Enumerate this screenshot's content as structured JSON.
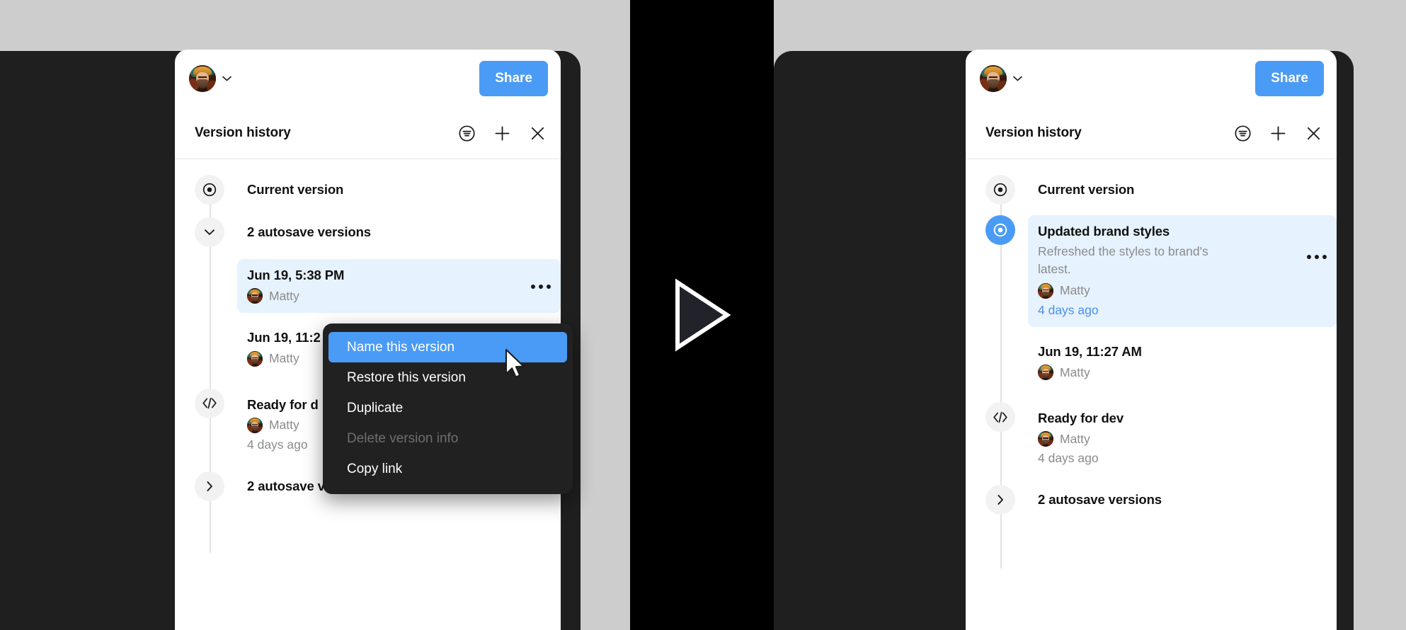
{
  "colors": {
    "accent_blue": "#4a9bf5",
    "selection_blue": "#e6f2fd",
    "link_blue": "#4a8ff0",
    "page_background": "#cdcdcd",
    "device_frame": "#1f1f1f",
    "band_black": "#000000",
    "menu_background": "#212121",
    "muted_text": "#8b8b8b"
  },
  "panels": {
    "left": {
      "topbar": {
        "avatar_alt": "Matty",
        "chevron_label": "Open account menu",
        "share_label": "Share"
      },
      "header": {
        "title": "Version history",
        "actions": [
          {
            "name": "filter-icon",
            "label": "Filter versions"
          },
          {
            "name": "plus-icon",
            "label": "Add version"
          },
          {
            "name": "close-icon",
            "label": "Close version history"
          }
        ]
      },
      "entries": [
        {
          "node": "current",
          "title": "Current version",
          "description": "",
          "author": "",
          "time": "",
          "selected": false,
          "dots": false
        },
        {
          "node": "chevron-down",
          "title": "2 autosave versions",
          "description": "",
          "author": "",
          "time": "",
          "selected": false,
          "dots": false
        },
        {
          "node": "none",
          "title": "Jun 19, 5:38 PM",
          "description": "",
          "author": "Matty",
          "time": "",
          "selected": true,
          "dots": true
        },
        {
          "node": "none",
          "title": "Jun 19, 11:2",
          "description": "",
          "author": "Matty",
          "time": "",
          "selected": false,
          "dots": false
        },
        {
          "node": "code",
          "title": "Ready for d",
          "description": "",
          "author": "Matty",
          "time": "4 days ago",
          "selected": false,
          "dots": false
        },
        {
          "node": "chevron-right",
          "title": "2 autosave versions",
          "description": "",
          "author": "",
          "time": "",
          "selected": false,
          "dots": false
        }
      ]
    },
    "right": {
      "topbar": {
        "avatar_alt": "Matty",
        "chevron_label": "Open account menu",
        "share_label": "Share"
      },
      "header": {
        "title": "Version history",
        "actions": [
          {
            "name": "filter-icon",
            "label": "Filter versions"
          },
          {
            "name": "plus-icon",
            "label": "Add version"
          },
          {
            "name": "close-icon",
            "label": "Close version history"
          }
        ]
      },
      "entries": [
        {
          "node": "current",
          "title": "Current version",
          "description": "",
          "author": "",
          "time": "",
          "selected": false,
          "dots": false
        },
        {
          "node": "current-accent",
          "title": "Updated brand styles",
          "description": "Refreshed the styles to brand's latest.",
          "author": "Matty",
          "time": "4 days ago",
          "time_is_link": true,
          "selected": true,
          "dots": true
        },
        {
          "node": "none",
          "title": "Jun 19, 11:27 AM",
          "description": "",
          "author": "Matty",
          "time": "",
          "selected": false,
          "dots": false
        },
        {
          "node": "code",
          "title": "Ready for dev",
          "description": "",
          "author": "Matty",
          "time": "4 days ago",
          "selected": false,
          "dots": false
        },
        {
          "node": "chevron-right",
          "title": "2 autosave versions",
          "description": "",
          "author": "",
          "time": "",
          "selected": false,
          "dots": false
        }
      ]
    }
  },
  "context_menu": {
    "items": [
      {
        "label": "Name this version",
        "state": "active"
      },
      {
        "label": "Restore this version",
        "state": "normal"
      },
      {
        "label": "Duplicate",
        "state": "normal"
      },
      {
        "label": "Delete version info",
        "state": "disabled"
      },
      {
        "label": "Copy link",
        "state": "normal"
      }
    ]
  },
  "center": {
    "play_label": "Play"
  }
}
